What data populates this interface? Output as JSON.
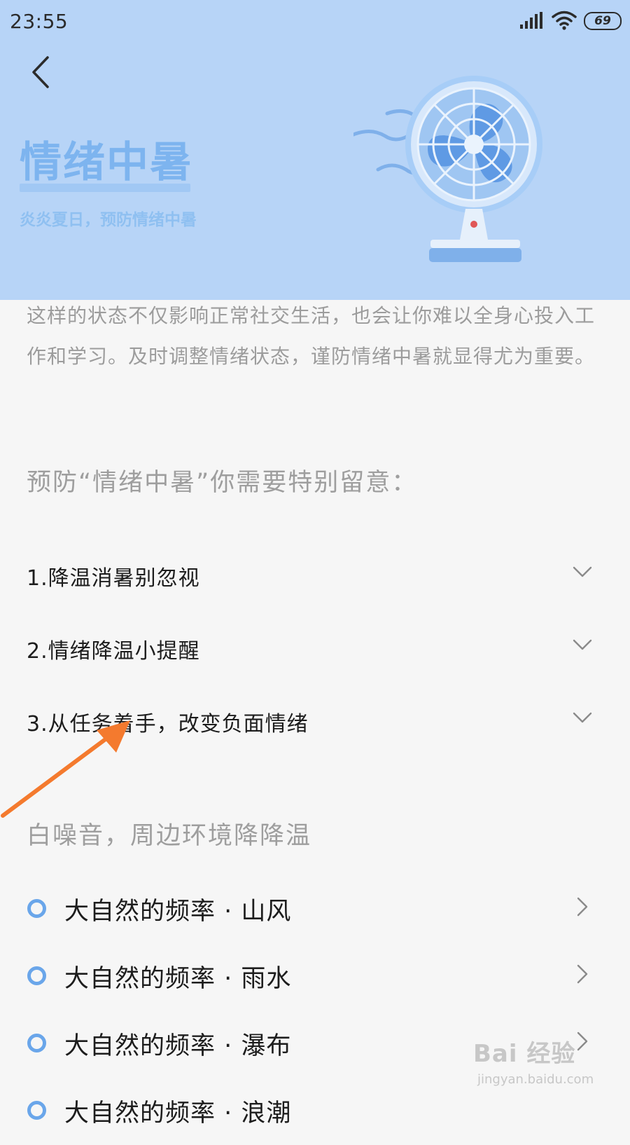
{
  "status_bar": {
    "time": "23:55",
    "battery": "69",
    "icons": [
      "signal-icon",
      "wifi-icon",
      "battery-icon"
    ]
  },
  "hero": {
    "title": "情绪中暑",
    "subtitle": "炎炎夏日，预防情绪中暑",
    "back_icon": "back-chevron-icon",
    "illustration": "fan-illustration"
  },
  "intro_text": "这样的状态不仅影响正常社交生活，也会让你难以全身心投入工作和学习。及时调整情绪状态，谨防情绪中暑就显得尤为重要。",
  "tips": {
    "heading": "预防“情绪中暑”你需要特别留意：",
    "items": [
      {
        "label": "1.降温消暑别忽视"
      },
      {
        "label": "2.情绪降温小提醒"
      },
      {
        "label": "3.从任务着手，改变负面情绪"
      }
    ]
  },
  "noise": {
    "heading": "白噪音，周边环境降降温",
    "items": [
      {
        "label": "大自然的频率 · 山风"
      },
      {
        "label": "大自然的频率 · 雨水"
      },
      {
        "label": "大自然的频率 · 瀑布"
      },
      {
        "label": "大自然的频率 · 浪潮"
      }
    ]
  },
  "watermark": {
    "text": "Bai 经验",
    "url": "jingyan.baidu.com"
  },
  "colors": {
    "hero_bg": "#b7d4f7",
    "accent": "#6aa6ea",
    "annotation_arrow": "#f47a2e"
  }
}
